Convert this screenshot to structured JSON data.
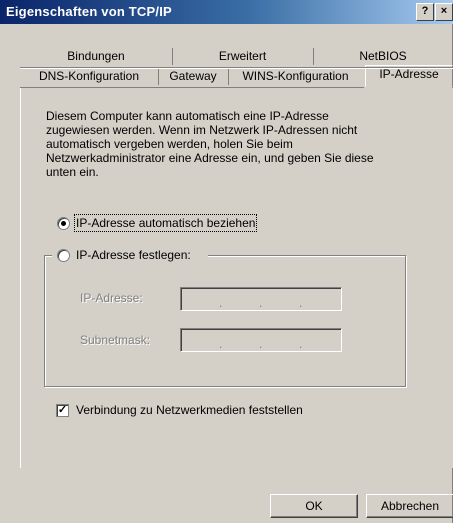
{
  "window": {
    "title": "Eigenschaften von TCP/IP",
    "help_button": "?",
    "close_button": "×"
  },
  "tabs": {
    "row1": [
      {
        "label": "Bindungen"
      },
      {
        "label": "Erweitert"
      },
      {
        "label": "NetBIOS"
      }
    ],
    "row2": [
      {
        "label": "DNS-Konfiguration"
      },
      {
        "label": "Gateway"
      },
      {
        "label": "WINS-Konfiguration"
      },
      {
        "label": "IP-Adresse",
        "active": true
      }
    ]
  },
  "description": "Diesem Computer kann automatisch eine IP-Adresse zugewiesen werden. Wenn im Netzwerk IP-Adressen nicht automatisch vergeben werden, holen Sie beim Netzwerkadministrator eine Adresse ein, und geben Sie diese unten ein.",
  "options": {
    "auto_label": "IP-Adresse automatisch beziehen",
    "auto_selected": true,
    "manual_label": "IP-Adresse festlegen:",
    "manual_selected": false
  },
  "fields": {
    "ip_label": "IP-Adresse:",
    "subnet_label": "Subnetmask:",
    "separator": "."
  },
  "checkbox": {
    "label": "Verbindung zu Netzwerkmedien feststellen",
    "checked": true,
    "mark": "✓"
  },
  "buttons": {
    "ok": "OK",
    "cancel": "Abbrechen"
  }
}
